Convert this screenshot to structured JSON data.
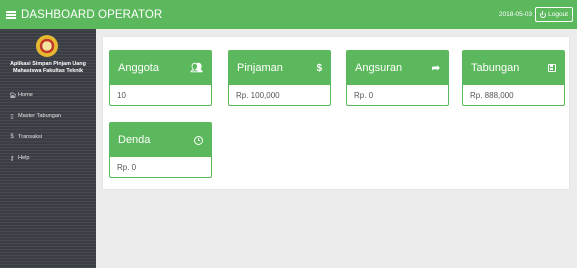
{
  "header": {
    "brand": "DASHBOARD OPERATOR",
    "date": "2018-05-03",
    "logout_label": "Logout",
    "accent_color": "#5cb85c"
  },
  "sidebar": {
    "app_name": "Aplikasi Simpan Pinjam Uang Mahasiswa Fakultas Teknik",
    "items": [
      {
        "label": "Home",
        "icon": "home-icon",
        "glyph": "🏠︎"
      },
      {
        "label": "Master Tabungan",
        "icon": "book-icon",
        "glyph": "▯"
      },
      {
        "label": "Transaksi",
        "icon": "dollar-icon",
        "glyph": "$"
      },
      {
        "label": "Help",
        "icon": "key-icon",
        "glyph": "⚷"
      }
    ]
  },
  "cards": [
    {
      "title": "Anggota",
      "value": "10",
      "icon": "users-icon",
      "glyph": "👥︎"
    },
    {
      "title": "Pinjaman",
      "value": "Rp. 100,000",
      "icon": "dollar-icon",
      "glyph": "$"
    },
    {
      "title": "Angsuran",
      "value": "Rp. 0",
      "icon": "share-icon",
      "glyph": "➦"
    },
    {
      "title": "Tabungan",
      "value": "Rp. 888,000",
      "icon": "save-icon",
      "glyph": ""
    },
    {
      "title": "Denda",
      "value": "Rp. 0",
      "icon": "clock-icon",
      "glyph": ""
    }
  ]
}
